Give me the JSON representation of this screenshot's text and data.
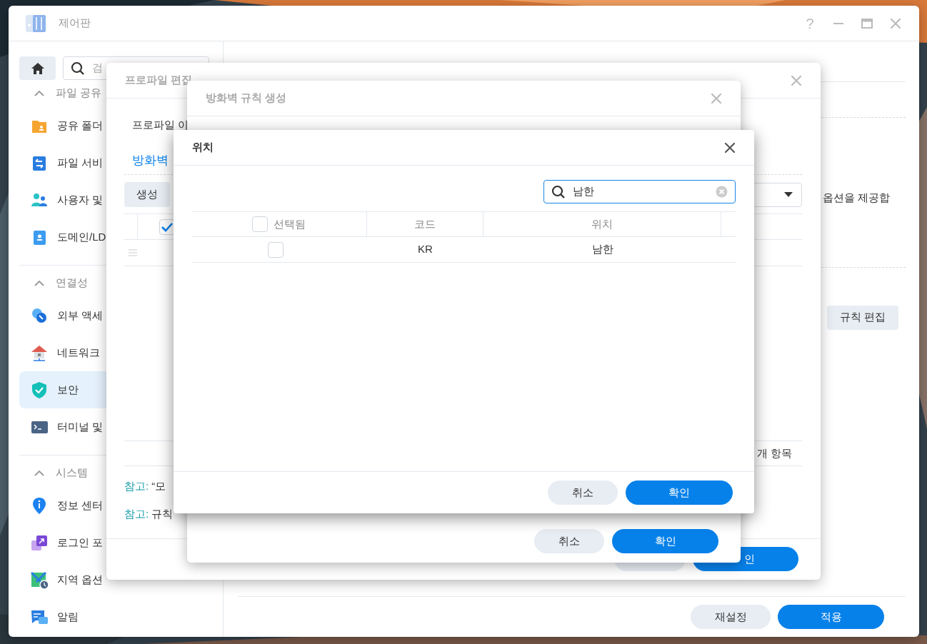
{
  "window": {
    "title": "제어판",
    "help": "?"
  },
  "sidebar": {
    "search_placeholder": "검",
    "sections": [
      {
        "title": "파일 공유",
        "expanded": true,
        "items": [
          {
            "label": "공유 폴더",
            "selected": false
          },
          {
            "label": "파일 서비",
            "selected": false
          },
          {
            "label": "사용자 및",
            "selected": false
          },
          {
            "label": "도메인/LD",
            "selected": false
          }
        ]
      },
      {
        "title": "연결성",
        "expanded": true,
        "items": [
          {
            "label": "외부 액세",
            "selected": false
          },
          {
            "label": "네트워크",
            "selected": false
          },
          {
            "label": "보안",
            "selected": true
          },
          {
            "label": "터미널 및",
            "selected": false
          }
        ]
      },
      {
        "title": "시스템",
        "expanded": true,
        "items": [
          {
            "label": "정보 센터",
            "selected": false
          },
          {
            "label": "로그인 포",
            "selected": false
          },
          {
            "label": "지역 옵션",
            "selected": false
          },
          {
            "label": "알림",
            "selected": false
          }
        ]
      }
    ]
  },
  "main_panel": {
    "description": "옵션을 제공합",
    "edit_rules_button": "규칙 편집",
    "buttons": [
      {
        "label": "재설정",
        "primary": false
      },
      {
        "label": "적용",
        "primary": true
      }
    ]
  },
  "profile_dialog": {
    "title": "프로파일 편집",
    "profile_label": "프로파일 이",
    "tab": "방화벽",
    "create_button": "생성",
    "header_checked": true,
    "item_count": "개 항목",
    "notes": [
      {
        "label": "참고:",
        "text": "“모"
      },
      {
        "label": "참고:",
        "text": "규칙"
      }
    ],
    "buttons": [
      {
        "primary": false
      },
      {
        "label": "인",
        "primary": true
      }
    ]
  },
  "rule_dialog": {
    "title": "방화벽 규칙 생성",
    "buttons": [
      {
        "label": "취소",
        "primary": false
      },
      {
        "label": "확인",
        "primary": true
      }
    ]
  },
  "location_dialog": {
    "title": "위치",
    "search": {
      "value": "남한"
    },
    "columns": [
      "선택됨",
      "코드",
      "위치"
    ],
    "select_all_checked": false,
    "rows": [
      {
        "checked": false,
        "code": "KR",
        "location": "남한"
      }
    ],
    "buttons": [
      {
        "label": "취소",
        "primary": false
      },
      {
        "label": "확인",
        "primary": true
      }
    ]
  }
}
